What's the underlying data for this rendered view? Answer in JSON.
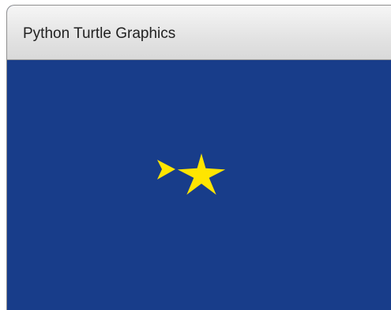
{
  "window": {
    "title": "Python Turtle Graphics"
  },
  "canvas": {
    "background_color": "#183d8a",
    "shapes": [
      {
        "kind": "turtle-arrow",
        "color": "#ffe500",
        "heading": "right"
      },
      {
        "kind": "star",
        "color": "#ffe500",
        "points": 5
      }
    ]
  }
}
